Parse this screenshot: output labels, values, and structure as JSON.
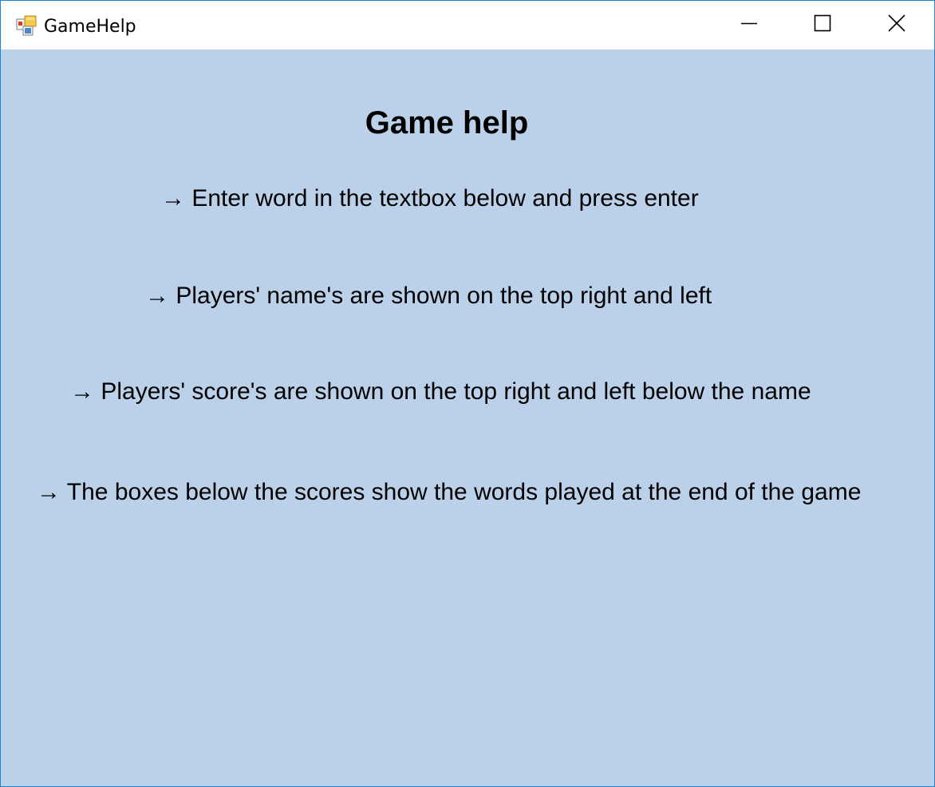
{
  "window": {
    "title": "GameHelp",
    "icon": "winforms-app-icon",
    "controls": {
      "minimize_icon": "minimize-icon",
      "maximize_icon": "maximize-icon",
      "close_icon": "close-icon"
    }
  },
  "content": {
    "heading": "Game help",
    "lines": [
      "→ Enter word in the textbox below and press enter",
      "→ Players' name's are shown on the top right and left",
      "→ Players' score's are shown on the top right and left below the name",
      "→ The boxes below the scores show the words played at the end of the game"
    ]
  },
  "colors": {
    "window_border": "#1883d7",
    "client_background": "#bbd0e9",
    "titlebar_background": "#ffffff",
    "text": "#000000"
  }
}
